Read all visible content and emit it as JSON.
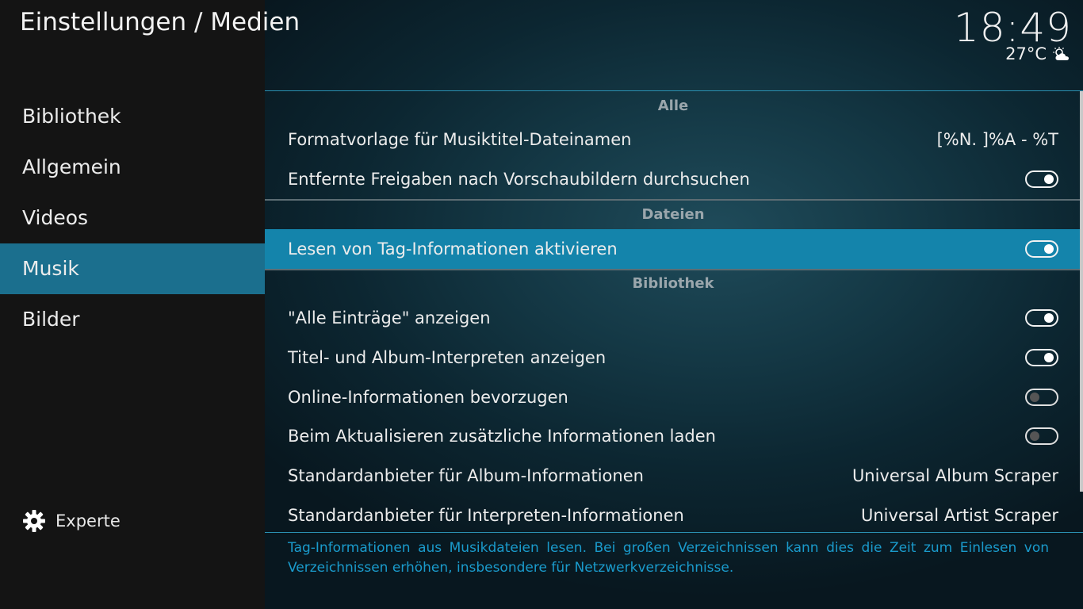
{
  "header": {
    "title": "Einstellungen / Medien"
  },
  "status": {
    "time": "18:49",
    "temperature": "27°C",
    "weather_icon": "partly-cloudy-icon"
  },
  "sidebar": {
    "items": [
      {
        "label": "Bibliothek",
        "active": false
      },
      {
        "label": "Allgemein",
        "active": false
      },
      {
        "label": "Videos",
        "active": false
      },
      {
        "label": "Musik",
        "active": true
      },
      {
        "label": "Bilder",
        "active": false
      }
    ],
    "level_label": "Experte",
    "level_icon": "gear-icon"
  },
  "settings": {
    "sections": [
      {
        "title": "Alle"
      },
      {
        "title": "Dateien"
      },
      {
        "title": "Bibliothek"
      }
    ],
    "rows": [
      {
        "label": "Formatvorlage für Musiktitel-Dateinamen",
        "value": "[%N. ]%A - %T"
      },
      {
        "label": "Entfernte Freigaben nach Vorschaubildern durchsuchen",
        "toggle": "on"
      },
      {
        "label": "Lesen von Tag-Informationen aktivieren",
        "toggle": "on",
        "focused": true
      },
      {
        "label": "\"Alle Einträge\" anzeigen",
        "toggle": "on"
      },
      {
        "label": "Titel- und Album-Interpreten anzeigen",
        "toggle": "on"
      },
      {
        "label": "Online-Informationen bevorzugen",
        "toggle": "off"
      },
      {
        "label": "Beim Aktualisieren zusätzliche Informationen laden",
        "toggle": "off"
      },
      {
        "label": "Standardanbieter für Album-Informationen",
        "value": "Universal Album Scraper"
      },
      {
        "label": "Standardanbieter für Interpreten-Informationen",
        "value": "Universal Artist Scraper"
      }
    ]
  },
  "description": "Tag-Informationen aus Musikdateien lesen. Bei großen Verzeichnissen kann dies die Zeit zum Einlesen von Verzeichnissen erhöhen, insbesondere für  Netzwerkverzeichnisse.",
  "colors": {
    "accent": "#1484ab",
    "sidebar_active": "#1b6f8e",
    "description_text": "#1a9bcc"
  }
}
